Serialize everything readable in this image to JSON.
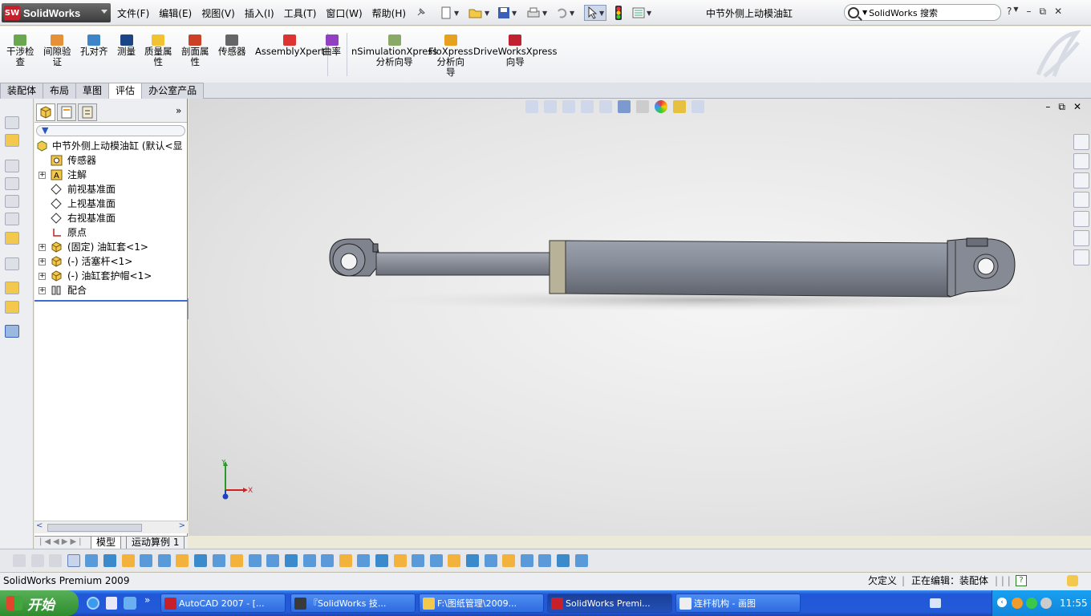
{
  "app": {
    "logo_text": "SolidWorks",
    "logo_badge": "SW",
    "doc_title": "中节外侧上动模油缸"
  },
  "menus": [
    "文件(F)",
    "编辑(E)",
    "视图(V)",
    "插入(I)",
    "工具(T)",
    "窗口(W)",
    "帮助(H)"
  ],
  "search": {
    "value": "SolidWorks 搜索"
  },
  "window_controls": {
    "help": "?",
    "minimize": "–",
    "restore": "⧉",
    "close": "✕"
  },
  "command_tools": [
    {
      "label": "干涉检\n查",
      "icon": "interference-check-icon"
    },
    {
      "label": "间隙验\n证",
      "icon": "clearance-verify-icon"
    },
    {
      "label": "孔对齐",
      "icon": "hole-align-icon"
    },
    {
      "label": "测量",
      "icon": "measure-icon"
    },
    {
      "label": "质量属\n性",
      "icon": "mass-properties-icon"
    },
    {
      "label": "剖面属\n性",
      "icon": "section-properties-icon"
    },
    {
      "label": "传感器",
      "icon": "sensor-icon"
    },
    {
      "label": "AssemblyXpert",
      "icon": "assemblyxpert-icon"
    },
    {
      "label": "曲率",
      "icon": "curvature-icon"
    },
    {
      "label": "nSimulationXpress\n分析向导",
      "icon": "simulationxpress-icon"
    },
    {
      "label": "FloXpress\n分析向\n导",
      "icon": "floxpress-icon"
    },
    {
      "label": "DriveWorksXpress\n向导",
      "icon": "driveworksxpress-icon"
    }
  ],
  "tabs": [
    {
      "label": "装配体",
      "active": false
    },
    {
      "label": "布局",
      "active": false
    },
    {
      "label": "草图",
      "active": false
    },
    {
      "label": "评估",
      "active": true
    },
    {
      "label": "办公室产品",
      "active": false
    }
  ],
  "feature_tree": {
    "root": "中节外侧上动模油缸  (默认<显",
    "items": [
      {
        "label": "传感器",
        "icon": "sensor-folder-icon",
        "expandable": false
      },
      {
        "label": "注解",
        "icon": "annotation-icon",
        "expandable": true
      },
      {
        "label": "前视基准面",
        "icon": "plane-icon",
        "expandable": false
      },
      {
        "label": "上视基准面",
        "icon": "plane-icon",
        "expandable": false
      },
      {
        "label": "右视基准面",
        "icon": "plane-icon",
        "expandable": false
      },
      {
        "label": "原点",
        "icon": "origin-icon",
        "expandable": false
      },
      {
        "label": "(固定) 油缸套<1>",
        "icon": "part-icon",
        "expandable": true
      },
      {
        "label": "(-) 活塞杆<1>",
        "icon": "part-icon",
        "expandable": true
      },
      {
        "label": "(-) 油缸套护帽<1>",
        "icon": "part-icon",
        "expandable": true
      },
      {
        "label": "配合",
        "icon": "mates-icon",
        "expandable": true
      }
    ]
  },
  "bottom_tabs": [
    "模型",
    "运动算例 1"
  ],
  "triad": {
    "y_label": "Y",
    "x_label": "X"
  },
  "status": {
    "product": "SolidWorks Premium 2009",
    "state": "欠定义",
    "editing": "正在编辑：装配体"
  },
  "taskbar": {
    "start_label": "开始",
    "tasks": [
      {
        "label": "AutoCAD 2007 - [...",
        "active": false
      },
      {
        "label": "『SolidWorks 技...",
        "active": false
      },
      {
        "label": "F:\\图纸管理\\2009...",
        "active": false
      },
      {
        "label": "SolidWorks Premi...",
        "active": true
      },
      {
        "label": "连杆机构 - 画图",
        "active": false
      }
    ],
    "clock": "11:55"
  },
  "colors": {
    "accent": "#2158d8",
    "brand_red": "#c8202a",
    "part_gray": "#8a8e98"
  }
}
